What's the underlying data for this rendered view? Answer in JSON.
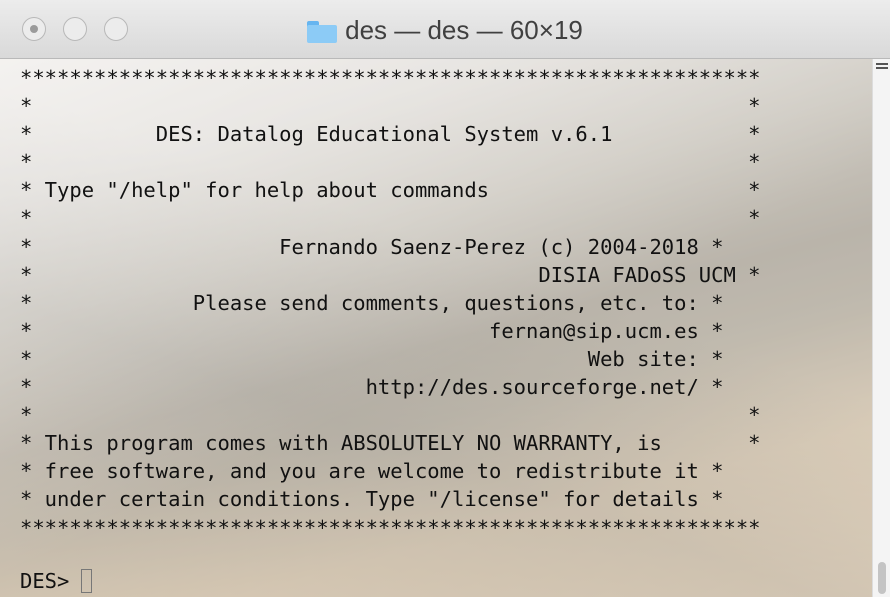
{
  "window": {
    "title": "des — des — 60×19",
    "title_icon": "folder-icon"
  },
  "terminal": {
    "banner_lines": [
      "************************************************************",
      "*                                                          *",
      "*          DES: Datalog Educational System v.6.1           *",
      "*                                                          *",
      "* Type \"/help\" for help about commands                     *",
      "*                                                          *",
      "*                    Fernando Saenz-Perez (c) 2004-2018 *",
      "*                                         DISIA FADoSS UCM *",
      "*             Please send comments, questions, etc. to: *",
      "*                                     fernan@sip.ucm.es *",
      "*                                             Web site: *",
      "*                           http://des.sourceforge.net/ *",
      "*                                                          *",
      "* This program comes with ABSOLUTELY NO WARRANTY, is       *",
      "* free software, and you are welcome to redistribute it *",
      "* under certain conditions. Type \"/license\" for details *",
      "************************************************************"
    ],
    "prompt": "DES>"
  },
  "colors": {
    "titlebar": "#e3e3e3",
    "text": "#111111"
  }
}
